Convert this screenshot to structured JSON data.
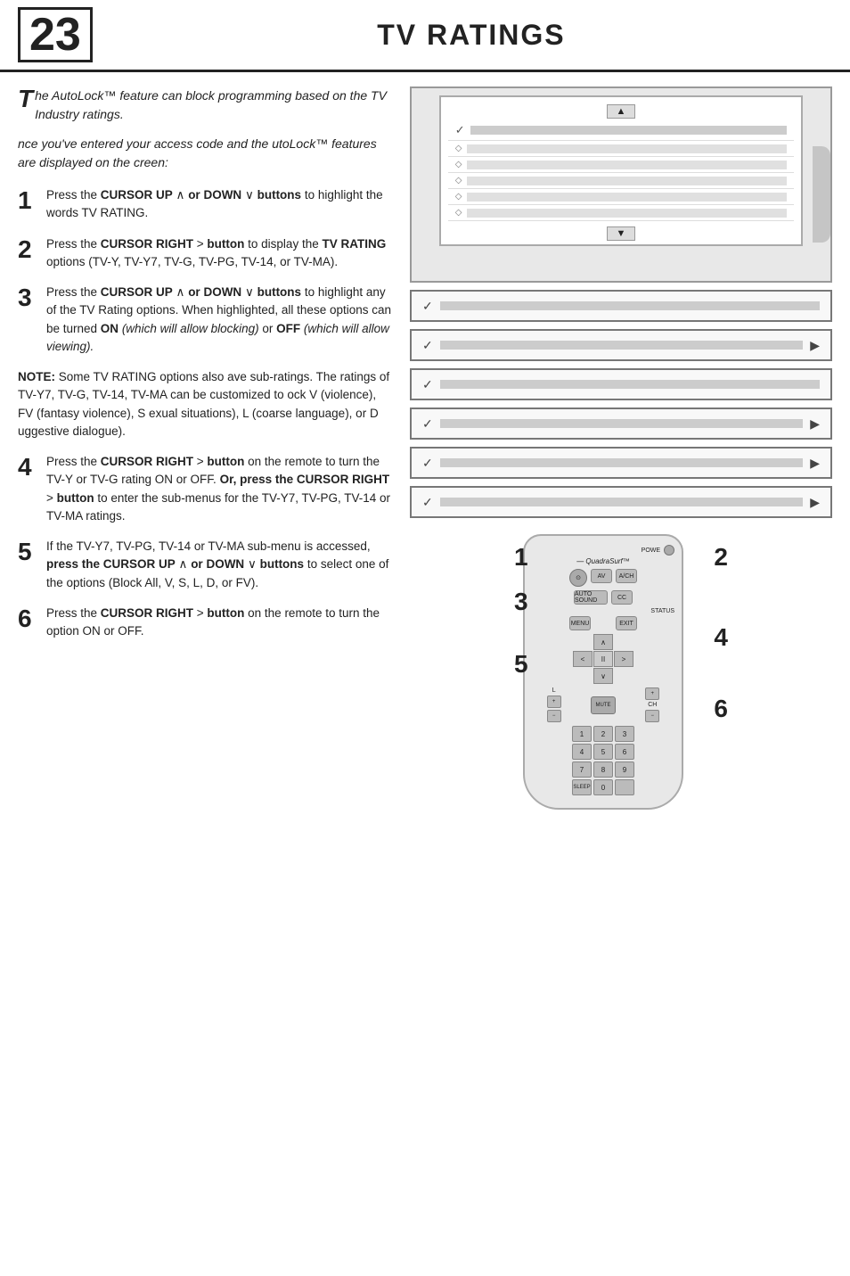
{
  "header": {
    "number": "23",
    "title": "TV Ratings"
  },
  "intro": {
    "drop_cap": "T",
    "text1": "he AutoLock™ feature can block programming based on the TV Industry ratings.",
    "text2": "nce you've entered your access code and the utoLock™ features are displayed on the creen:"
  },
  "steps": [
    {
      "number": "1",
      "text": "Press the CURSOR UP ∧ or DOWN ∨ buttons to highlight the words TV RATING."
    },
    {
      "number": "2",
      "text": "Press the CURSOR RIGHT > button to display the TV RATING options (TV-Y, TV-Y7, TV-G, TV-PG, TV-14, or TV-MA)."
    },
    {
      "number": "3",
      "text": "Press the CURSOR UP ∧ or DOWN ∨ buttons to highlight any of the TV Rating options. When highlighted, all these options can be turned ON (which will allow blocking) or OFF (which will allow viewing)."
    },
    {
      "number": "4",
      "text": "Press the CURSOR RIGHT > button on the remote to turn the TV-Y or TV-G rating ON or OFF. Or, press the CURSOR RIGHT > button to enter the sub-menus for the TV-Y7, TV-PG, TV-14 or TV-MA ratings."
    },
    {
      "number": "5",
      "text": "If the TV-Y7, TV-PG, TV-14 or TV-MA sub-menu is accessed, press the CURSOR UP ∧ or DOWN ∨ buttons to select one of the options (Block All, V, S, L, D, or FV)."
    },
    {
      "number": "6",
      "text": "Press the CURSOR RIGHT > button on the remote to turn the option ON or OFF."
    }
  ],
  "note": {
    "label": "NOTE:",
    "text": "Some TV RATING options also ave sub-ratings. The ratings of TV-Y7, TV-G, TV-14, TV-MA can be customized to ock V (violence), FV (fantasy violence), S exual situations), L (coarse language), or D uggestive dialogue)."
  },
  "ui_panels": {
    "top_panel": {
      "up_arrow": "▲",
      "down_arrow": "▼",
      "check_row": "✓",
      "diamond_rows": [
        "◇",
        "◇",
        "◇",
        "◇",
        "◇"
      ]
    },
    "horizontal_panels": [
      {
        "check": "✓",
        "label": "",
        "has_arrow": false
      },
      {
        "check": "✓",
        "label": "",
        "has_arrow": true
      },
      {
        "check": "✓",
        "label": "",
        "has_arrow": false
      },
      {
        "check": "✓",
        "label": "",
        "has_arrow": true
      },
      {
        "check": "✓",
        "label": "",
        "has_arrow": true
      },
      {
        "check": "✓",
        "label": "",
        "has_arrow": true
      }
    ]
  },
  "remote": {
    "brand": "QuadraSurf™",
    "power_label": "POWER",
    "buttons": {
      "top_row": [
        "⊙",
        "AV",
        "A/CH"
      ],
      "mid_row": [
        "AUTO SOUND",
        "CC"
      ],
      "status": "STATUS",
      "menu": "MENU",
      "exit": "EXIT",
      "dpad": {
        "up": "∧",
        "down": "∨",
        "left": "<",
        "right": ">",
        "center": "II"
      },
      "vol_plus": "+",
      "vol_minus": "−",
      "mute": "MUTE",
      "ch_plus": "+",
      "ch_minus": "CH",
      "numbers": [
        "1",
        "2",
        "3",
        "4",
        "5",
        "6",
        "7",
        "8",
        "9",
        "SLEEP",
        "0",
        ""
      ]
    },
    "overlay_numbers": [
      "1",
      "3",
      "5",
      "2",
      "4",
      "6"
    ]
  }
}
